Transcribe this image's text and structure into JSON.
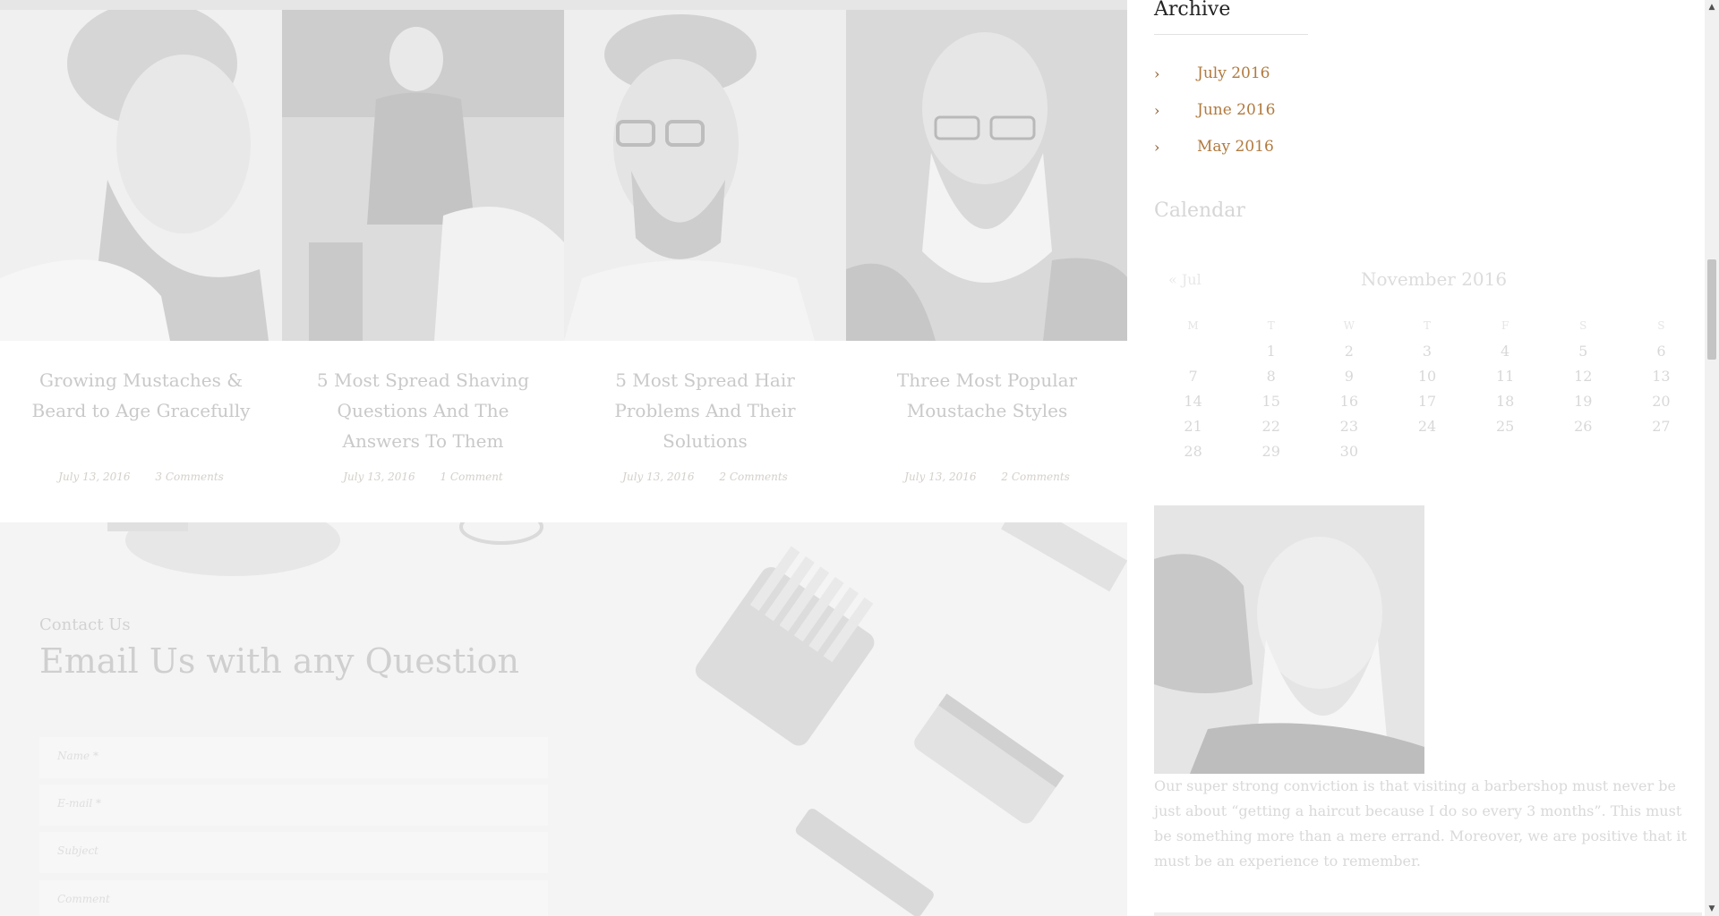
{
  "posts": [
    {
      "title": "Growing Mustaches & Beard to Age Gracefully",
      "date": "July 13, 2016",
      "comments": "3 Comments"
    },
    {
      "title": "5 Most Spread Shaving Questions And The Answers To Them",
      "date": "July 13, 2016",
      "comments": "1 Comment"
    },
    {
      "title": "5 Most Spread Hair Problems And Their Solutions",
      "date": "July 13, 2016",
      "comments": "2 Comments"
    },
    {
      "title": "Three Most Popular Moustache Styles",
      "date": "July 13, 2016",
      "comments": "2 Comments"
    }
  ],
  "contact": {
    "eyebrow": "Contact Us",
    "heading": "Email Us with any Question",
    "fields": [
      "Name *",
      "E-mail *",
      "Subject",
      "Comment"
    ]
  },
  "sidebar": {
    "archive": {
      "title": "Archive",
      "items": [
        "July 2016",
        "June 2016",
        "May 2016"
      ]
    },
    "calendar": {
      "title": "Calendar",
      "prev": "« Jul",
      "month": "November 2016",
      "weekdays": [
        "M",
        "T",
        "W",
        "T",
        "F",
        "S",
        "S"
      ],
      "weeks": [
        [
          "",
          "1",
          "2",
          "3",
          "4",
          "5",
          "6"
        ],
        [
          "7",
          "8",
          "9",
          "10",
          "11",
          "12",
          "13"
        ],
        [
          "14",
          "15",
          "16",
          "17",
          "18",
          "19",
          "20"
        ],
        [
          "21",
          "22",
          "23",
          "24",
          "25",
          "26",
          "27"
        ],
        [
          "28",
          "29",
          "30",
          "",
          "",
          "",
          ""
        ]
      ]
    },
    "about_text": "Our super strong conviction is that visiting a barbershop must never be just about “getting a haircut because I do so every 3 months”. This must be something more than a mere errand. Moreover, we are positive that it must be an experience to remember."
  },
  "colors": {
    "accent": "#b07a3f",
    "chevron": "#8a5a2a",
    "faded_text": "#cfcfcf"
  },
  "icons": {
    "archive_bullet": "chevron-right-icon",
    "scroll_up": "triangle-up-icon",
    "scroll_down": "triangle-down-icon"
  }
}
